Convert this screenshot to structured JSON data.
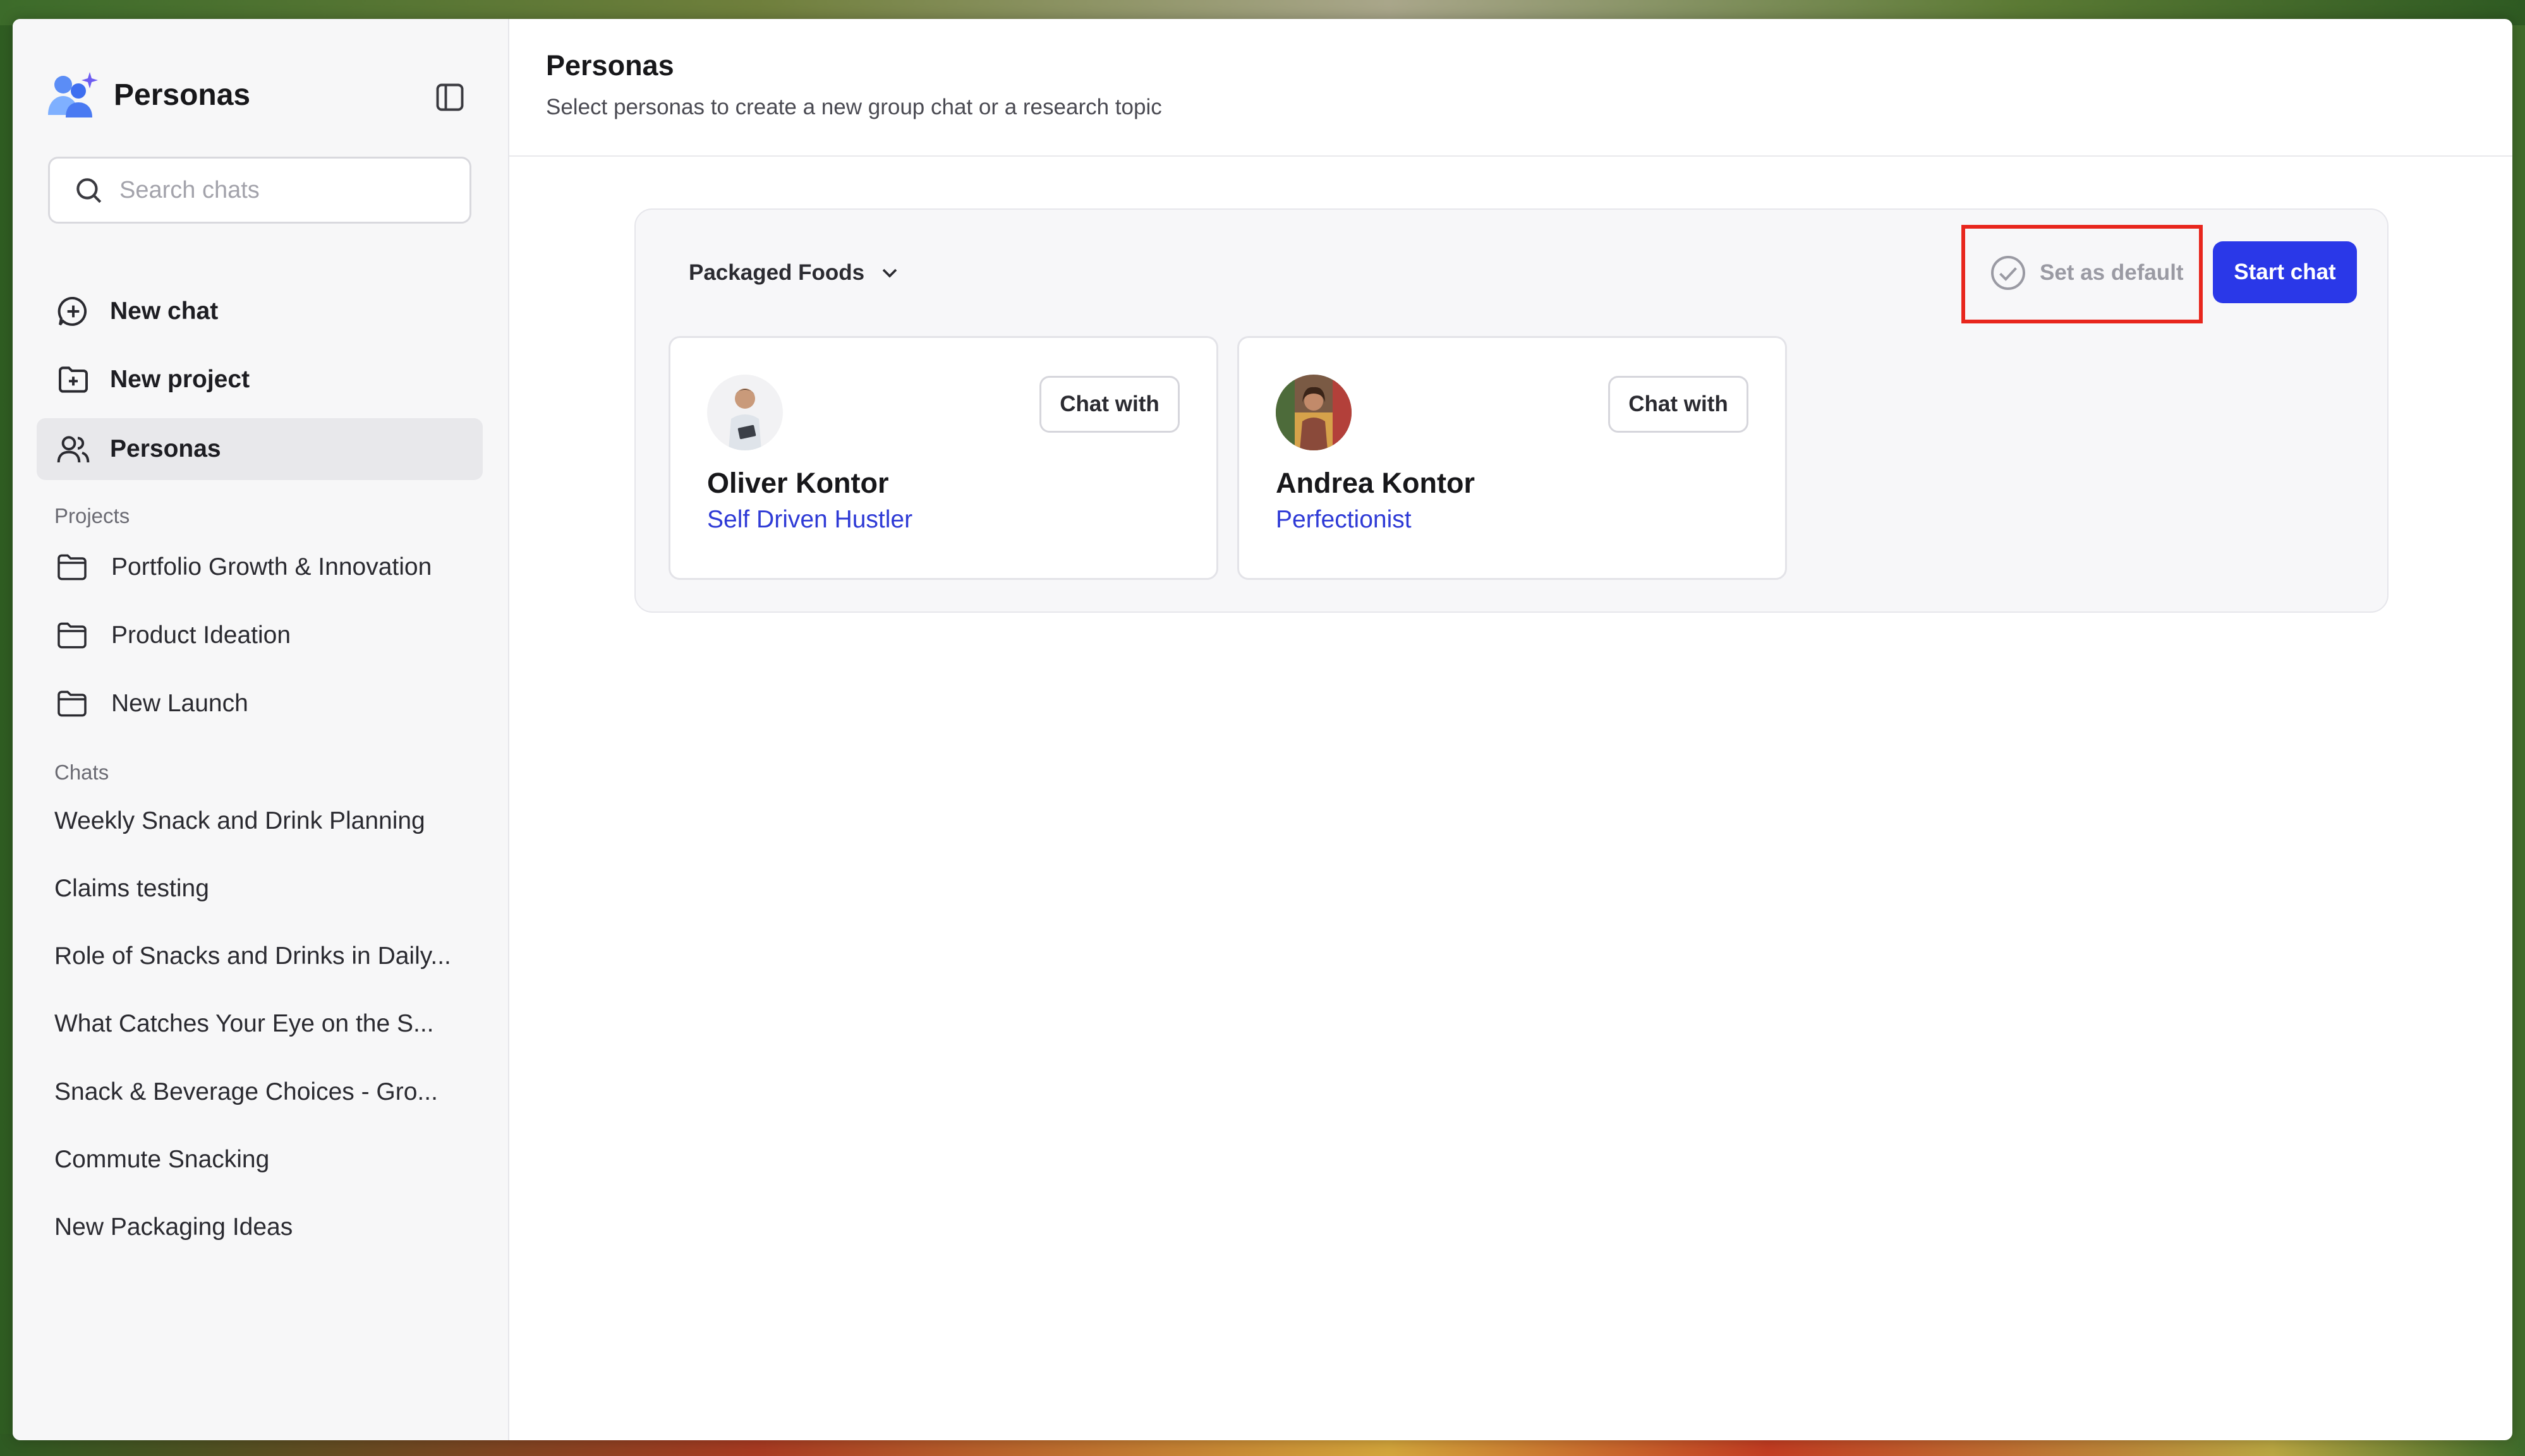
{
  "app": {
    "title": "Personas",
    "search_placeholder": "Search chats"
  },
  "nav": [
    {
      "label": "New chat",
      "icon": "chat-plus-icon"
    },
    {
      "label": "New project",
      "icon": "folder-plus-icon"
    },
    {
      "label": "Personas",
      "icon": "users-icon",
      "active": true
    }
  ],
  "projects": {
    "label": "Projects",
    "items": [
      "Portfolio Growth & Innovation",
      "Product Ideation",
      "New Launch"
    ]
  },
  "chats": {
    "label": "Chats",
    "items": [
      "Weekly Snack and Drink Planning",
      "Claims testing",
      "Role of Snacks and Drinks in Daily...",
      "What Catches Your Eye on the S...",
      "Snack & Beverage Choices - Gro...",
      "Commute Snacking",
      "New Packaging Ideas"
    ]
  },
  "header": {
    "title": "Personas",
    "subtitle": "Select personas to create a new group chat or a research topic"
  },
  "panel": {
    "category": "Packaged Foods",
    "set_default_label": "Set as default",
    "start_chat_label": "Start chat"
  },
  "personas": [
    {
      "name": "Oliver Kontor",
      "type": "Self Driven Hustler",
      "chat_label": "Chat with"
    },
    {
      "name": "Andrea Kontor",
      "type": "Perfectionist",
      "chat_label": "Chat with"
    }
  ],
  "colors": {
    "accent": "#2a38e8",
    "persona_type": "#2e3ad6",
    "highlight": "#e8261d"
  }
}
